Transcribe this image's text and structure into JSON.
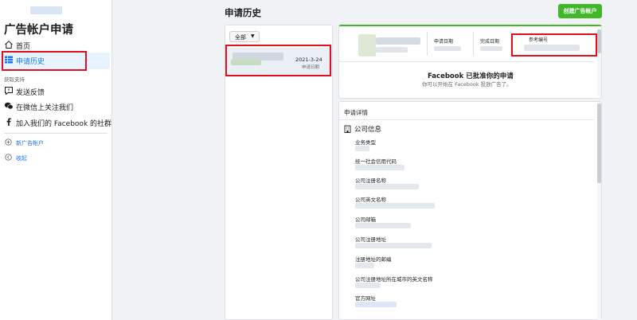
{
  "sidebar": {
    "title": "广告帐户申请",
    "items": [
      {
        "label": "首页",
        "icon": "home-icon"
      },
      {
        "label": "申请历史",
        "icon": "table-icon",
        "active": true
      }
    ],
    "section_label": "获取支持",
    "support_items": [
      {
        "label": "发送反馈",
        "icon": "feedback-icon"
      },
      {
        "label": "在微信上关注我们",
        "icon": "wechat-icon"
      },
      {
        "label": "加入我们的 Facebook 的社群",
        "icon": "facebook-icon"
      }
    ],
    "actions": [
      {
        "label": "新广告帐户",
        "icon": "plus-circle-icon"
      },
      {
        "label": "收起",
        "icon": "collapse-icon"
      }
    ]
  },
  "header": {
    "title": "申请历史",
    "create_button": "创建广告帐户"
  },
  "list": {
    "filter_label": "全部",
    "items": [
      {
        "date": "2021-3-24",
        "sub": "申请日期"
      }
    ]
  },
  "detail": {
    "columns": [
      "申请日期",
      "完成日期",
      "参考编号"
    ],
    "approval_title": "Facebook 已批准你的申请",
    "approval_sub": "你可以开始在 Facebook 投放广告了。",
    "details_heading": "申请详情",
    "company_title": "公司信息",
    "fields": [
      "业务类型",
      "统一社会信用代码",
      "公司注册名称",
      "公司英文名称",
      "公司邮箱",
      "公司注册地址",
      "注册地址的邮编",
      "公司注册地址所在城市的英文名称",
      "官方网址"
    ]
  },
  "colors": {
    "accent": "#1877f2",
    "success": "#42b72a",
    "highlight": "#e0101e"
  }
}
